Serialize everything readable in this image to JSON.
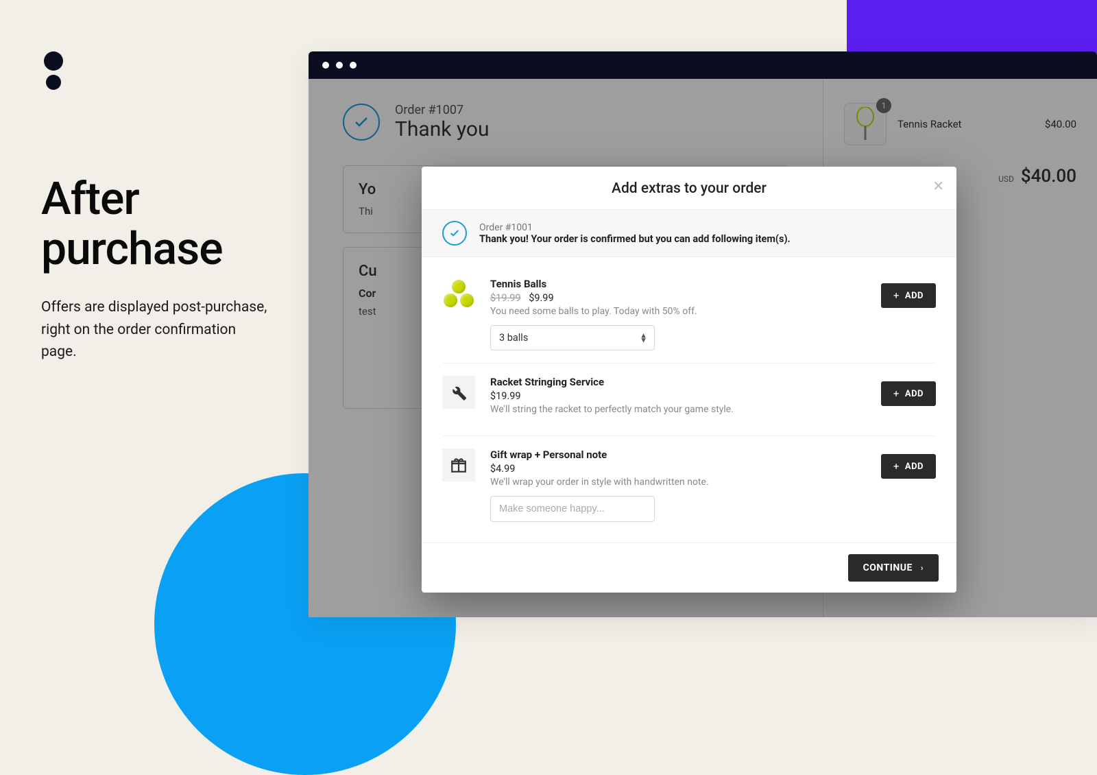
{
  "marketing": {
    "title": "After purchase",
    "subtitle": "Offers are displayed post-purchase, right on the order confirmation page."
  },
  "page": {
    "order_number": "Order #1007",
    "thank_you": "Thank you",
    "card1_title": "Yo",
    "card1_sub": "Thi",
    "card2_title": "Cu",
    "card2_label": "Cor",
    "card2_value": "test"
  },
  "cart": {
    "item_name": "Tennis Racket",
    "item_price": "$40.00",
    "qty": "1",
    "currency": "USD",
    "total": "$40.00"
  },
  "modal": {
    "title": "Add extras to your order",
    "order_number": "Order #1001",
    "confirm_msg": "Thank you! Your order is confirmed but you can add following item(s).",
    "continue_label": "CONTINUE",
    "add_label": "ADD",
    "items": [
      {
        "title": "Tennis Balls",
        "old_price": "$19.99",
        "price": "$9.99",
        "desc": "You need some balls to play. Today with 50% off.",
        "select_value": "3 balls"
      },
      {
        "title": "Racket Stringing Service",
        "price": "$19.99",
        "desc": "We'll string the racket to perfectly match your game style."
      },
      {
        "title": "Gift wrap + Personal note",
        "price": "$4.99",
        "desc": "We'll wrap your order in style with handwritten note.",
        "placeholder": "Make someone happy..."
      }
    ]
  }
}
